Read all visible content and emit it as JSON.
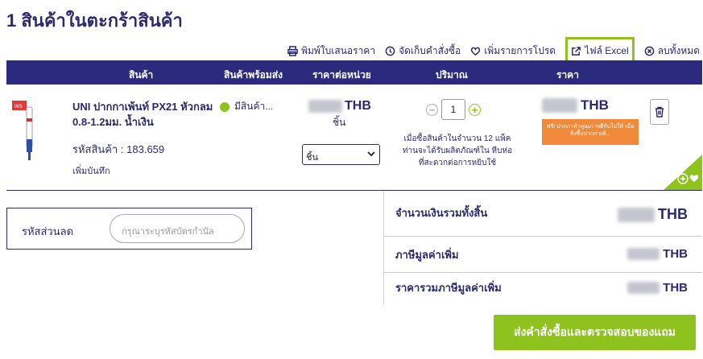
{
  "page": {
    "title": "1 สินค้าในตะกร้าสินค้า"
  },
  "toolbar": {
    "print_label": "พิมพ์ใบเสนอราคา",
    "save_order_label": "จัดเก็บคำสั่งซื้อ",
    "favorite_label": "เพิ่มรายการโปรด",
    "excel_label": "ไฟล์ Excel",
    "clear_all_label": "ลบทั้งหมด"
  },
  "table": {
    "headers": {
      "product": "สินค้า",
      "stock": "สินค้าพร้อมส่ง",
      "unit_price": "ราคาต่อหน่วย",
      "quantity": "ปริมาณ",
      "price": "ราคา"
    }
  },
  "item": {
    "name": "UNI ปากกาเพ้นท์ PX21 หัวกลม 0.8-1.2มม. น้ำเงิน",
    "sku": "รหัสสินค้า : 183.659",
    "add_note": "เพิ่มบันทึก",
    "stock_status": "มีสินค้า...",
    "currency": "THB",
    "unit": "ชิ้น",
    "unit_option": "ชิ้น",
    "quantity": "1",
    "qty_note": "เมื่อซื้อสินค้าในจำนวน 12 แพ็ค ท่านจะได้รับผลิตภัณฑ์ใน หีบห่อที่สะดวกต่อการหยิบใช้",
    "promo_text": "ฟรี! ปากกาหัวคุณภาพดีกับไปให้ เมื่อสั่งซื้อปากกาเพ้...",
    "image_badge": "WS"
  },
  "discount": {
    "label": "รหัสส่วนลด",
    "placeholder": "กรุณาระบุรหัสบัตรกำนัล"
  },
  "summary": {
    "total_label": "จำนวนเงินรวมทั้งสิ้น",
    "vat_label": "ภาษีมูลค่าเพิ่ม",
    "total_incl_vat_label": "ราคารวมภาษีมูลค่าเพิ่ม",
    "currency": "THB"
  },
  "checkout": {
    "label": "ส่งคำสั่งซื้อและตรวจสอบของแถม"
  },
  "colors": {
    "navy": "#2c2a7e",
    "green": "#8dc21f",
    "orange": "#f08a3a"
  }
}
